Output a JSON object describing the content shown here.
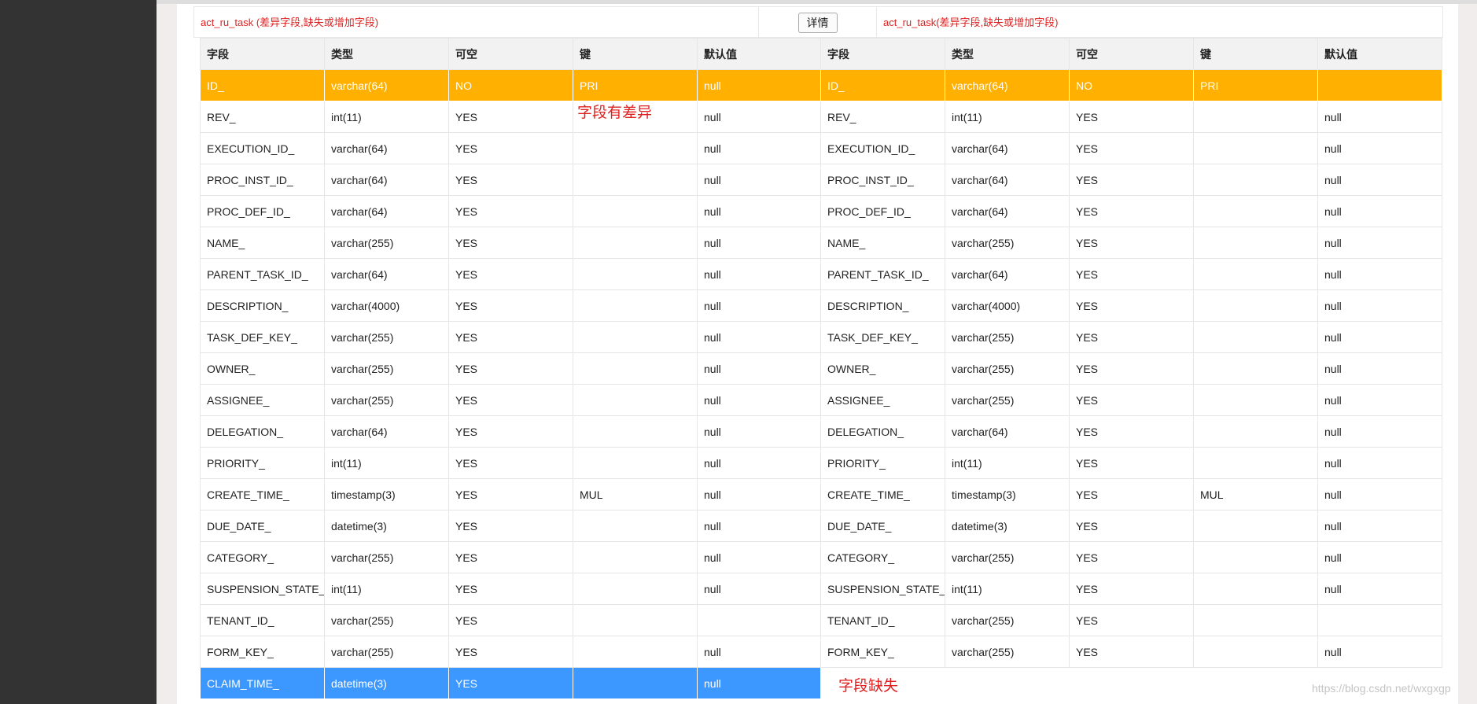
{
  "header": {
    "left_title": "act_ru_task (差异字段,缺失或增加字段)",
    "detail_button": "详情",
    "right_title": "act_ru_task(差异字段,缺失或增加字段)"
  },
  "columns": [
    "字段",
    "类型",
    "可空",
    "键",
    "默认值"
  ],
  "left_rows": [
    {
      "field": "ID_",
      "type": "varchar(64)",
      "nullable": "NO",
      "key": "PRI",
      "default": "null",
      "status": "diff"
    },
    {
      "field": "REV_",
      "type": "int(11)",
      "nullable": "YES",
      "key": "",
      "default": "null",
      "status": ""
    },
    {
      "field": "EXECUTION_ID_",
      "type": "varchar(64)",
      "nullable": "YES",
      "key": "",
      "default": "null",
      "status": ""
    },
    {
      "field": "PROC_INST_ID_",
      "type": "varchar(64)",
      "nullable": "YES",
      "key": "",
      "default": "null",
      "status": ""
    },
    {
      "field": "PROC_DEF_ID_",
      "type": "varchar(64)",
      "nullable": "YES",
      "key": "",
      "default": "null",
      "status": ""
    },
    {
      "field": "NAME_",
      "type": "varchar(255)",
      "nullable": "YES",
      "key": "",
      "default": "null",
      "status": ""
    },
    {
      "field": "PARENT_TASK_ID_",
      "type": "varchar(64)",
      "nullable": "YES",
      "key": "",
      "default": "null",
      "status": ""
    },
    {
      "field": "DESCRIPTION_",
      "type": "varchar(4000)",
      "nullable": "YES",
      "key": "",
      "default": "null",
      "status": ""
    },
    {
      "field": "TASK_DEF_KEY_",
      "type": "varchar(255)",
      "nullable": "YES",
      "key": "",
      "default": "null",
      "status": ""
    },
    {
      "field": "OWNER_",
      "type": "varchar(255)",
      "nullable": "YES",
      "key": "",
      "default": "null",
      "status": ""
    },
    {
      "field": "ASSIGNEE_",
      "type": "varchar(255)",
      "nullable": "YES",
      "key": "",
      "default": "null",
      "status": ""
    },
    {
      "field": "DELEGATION_",
      "type": "varchar(64)",
      "nullable": "YES",
      "key": "",
      "default": "null",
      "status": ""
    },
    {
      "field": "PRIORITY_",
      "type": "int(11)",
      "nullable": "YES",
      "key": "",
      "default": "null",
      "status": ""
    },
    {
      "field": "CREATE_TIME_",
      "type": "timestamp(3)",
      "nullable": "YES",
      "key": "MUL",
      "default": "null",
      "status": ""
    },
    {
      "field": "DUE_DATE_",
      "type": "datetime(3)",
      "nullable": "YES",
      "key": "",
      "default": "null",
      "status": ""
    },
    {
      "field": "CATEGORY_",
      "type": "varchar(255)",
      "nullable": "YES",
      "key": "",
      "default": "null",
      "status": ""
    },
    {
      "field": "SUSPENSION_STATE_",
      "type": "int(11)",
      "nullable": "YES",
      "key": "",
      "default": "null",
      "status": ""
    },
    {
      "field": "TENANT_ID_",
      "type": "varchar(255)",
      "nullable": "YES",
      "key": "",
      "default": "",
      "status": ""
    },
    {
      "field": "FORM_KEY_",
      "type": "varchar(255)",
      "nullable": "YES",
      "key": "",
      "default": "null",
      "status": ""
    },
    {
      "field": "CLAIM_TIME_",
      "type": "datetime(3)",
      "nullable": "YES",
      "key": "",
      "default": "null",
      "status": "missing"
    }
  ],
  "right_rows": [
    {
      "field": "ID_",
      "type": "varchar(64)",
      "nullable": "NO",
      "key": "PRI",
      "default": "",
      "status": "diff"
    },
    {
      "field": "REV_",
      "type": "int(11)",
      "nullable": "YES",
      "key": "",
      "default": "null",
      "status": ""
    },
    {
      "field": "EXECUTION_ID_",
      "type": "varchar(64)",
      "nullable": "YES",
      "key": "",
      "default": "null",
      "status": ""
    },
    {
      "field": "PROC_INST_ID_",
      "type": "varchar(64)",
      "nullable": "YES",
      "key": "",
      "default": "null",
      "status": ""
    },
    {
      "field": "PROC_DEF_ID_",
      "type": "varchar(64)",
      "nullable": "YES",
      "key": "",
      "default": "null",
      "status": ""
    },
    {
      "field": "NAME_",
      "type": "varchar(255)",
      "nullable": "YES",
      "key": "",
      "default": "null",
      "status": ""
    },
    {
      "field": "PARENT_TASK_ID_",
      "type": "varchar(64)",
      "nullable": "YES",
      "key": "",
      "default": "null",
      "status": ""
    },
    {
      "field": "DESCRIPTION_",
      "type": "varchar(4000)",
      "nullable": "YES",
      "key": "",
      "default": "null",
      "status": ""
    },
    {
      "field": "TASK_DEF_KEY_",
      "type": "varchar(255)",
      "nullable": "YES",
      "key": "",
      "default": "null",
      "status": ""
    },
    {
      "field": "OWNER_",
      "type": "varchar(255)",
      "nullable": "YES",
      "key": "",
      "default": "null",
      "status": ""
    },
    {
      "field": "ASSIGNEE_",
      "type": "varchar(255)",
      "nullable": "YES",
      "key": "",
      "default": "null",
      "status": ""
    },
    {
      "field": "DELEGATION_",
      "type": "varchar(64)",
      "nullable": "YES",
      "key": "",
      "default": "null",
      "status": ""
    },
    {
      "field": "PRIORITY_",
      "type": "int(11)",
      "nullable": "YES",
      "key": "",
      "default": "null",
      "status": ""
    },
    {
      "field": "CREATE_TIME_",
      "type": "timestamp(3)",
      "nullable": "YES",
      "key": "MUL",
      "default": "null",
      "status": ""
    },
    {
      "field": "DUE_DATE_",
      "type": "datetime(3)",
      "nullable": "YES",
      "key": "",
      "default": "null",
      "status": ""
    },
    {
      "field": "CATEGORY_",
      "type": "varchar(255)",
      "nullable": "YES",
      "key": "",
      "default": "null",
      "status": ""
    },
    {
      "field": "SUSPENSION_STATE_",
      "type": "int(11)",
      "nullable": "YES",
      "key": "",
      "default": "null",
      "status": ""
    },
    {
      "field": "TENANT_ID_",
      "type": "varchar(255)",
      "nullable": "YES",
      "key": "",
      "default": "",
      "status": ""
    },
    {
      "field": "FORM_KEY_",
      "type": "varchar(255)",
      "nullable": "YES",
      "key": "",
      "default": "null",
      "status": ""
    },
    {
      "field": "",
      "type": "",
      "nullable": "",
      "key": "",
      "default": "",
      "status": "empty"
    }
  ],
  "annotations": {
    "diff_note": "字段有差异",
    "missing_note": "字段缺失"
  },
  "watermark": "https://blog.csdn.net/wxgxgp",
  "colors": {
    "diff_row": "#ffb000",
    "missing_row": "#3c97ff",
    "annotation_text": "#e02020",
    "header_text": "#e02020"
  }
}
